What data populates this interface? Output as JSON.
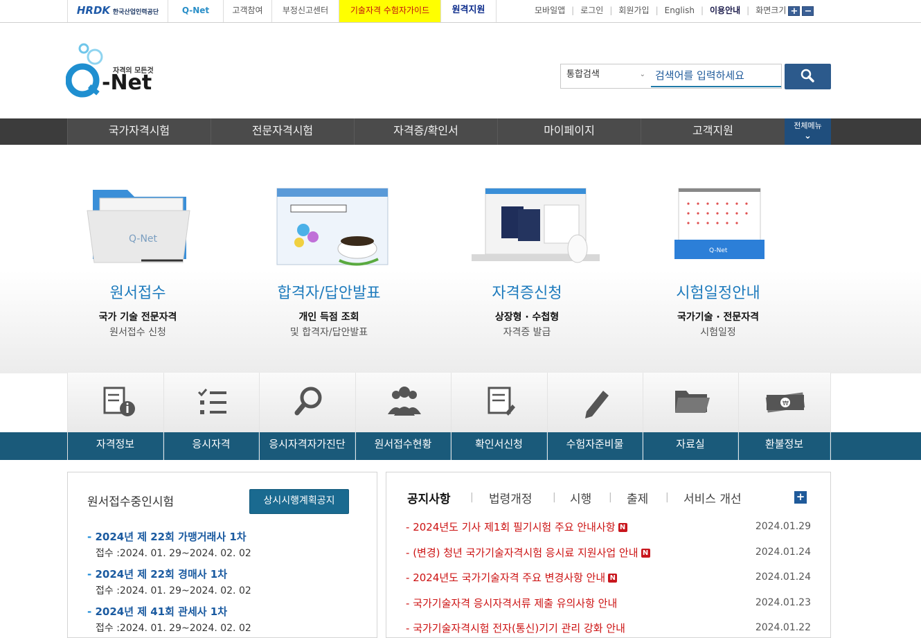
{
  "topbar": {
    "hrdk_label": "HRDK",
    "hrdk_sub": "한국산업인력공단",
    "qnet_label": "Q-Net",
    "links": [
      "고객참여",
      "부정신고센터",
      "기술자격 수험자가이드",
      "원격지원"
    ],
    "util_links": [
      "모바일앱",
      "로그인",
      "회원가입",
      "English",
      "이용안내",
      "화면크기"
    ],
    "zoom_in": "+",
    "zoom_out": "−"
  },
  "logo": {
    "tagline": "자격의 모든것",
    "name": "-Net"
  },
  "search": {
    "category": "통합검색",
    "placeholder": "검색어를 입력하세요"
  },
  "nav": {
    "items": [
      "국가자격시험",
      "전문자격시험",
      "자격증/확인서",
      "마이페이지",
      "고객지원"
    ],
    "all_menu": "전체메뉴"
  },
  "hero": [
    {
      "title": "원서접수",
      "sub1": "국가 기술 전문자격",
      "sub2": "원서접수 신청",
      "icon": "folder-icon"
    },
    {
      "title": "합격자/답안발표",
      "sub1": "개인 득점 조회",
      "sub2": "및 합격자/답안발표",
      "icon": "browser-icon"
    },
    {
      "title": "자격증신청",
      "sub1": "상장형 · 수첩형",
      "sub2": "자격증 발급",
      "icon": "certificate-icon"
    },
    {
      "title": "시험일정안내",
      "sub1": "국가기술 · 전문자격",
      "sub2": "시험일정",
      "icon": "calendar-icon"
    }
  ],
  "quick": [
    {
      "label": "자격정보",
      "icon": "info-document-icon"
    },
    {
      "label": "응시자격",
      "icon": "checklist-icon"
    },
    {
      "label": "응시자격자가진단",
      "icon": "search-icon"
    },
    {
      "label": "원서접수현황",
      "icon": "people-icon"
    },
    {
      "label": "확인서신청",
      "icon": "edit-document-icon"
    },
    {
      "label": "수험자준비물",
      "icon": "pencil-icon"
    },
    {
      "label": "자료실",
      "icon": "folder-icon"
    },
    {
      "label": "환불정보",
      "icon": "money-icon"
    }
  ],
  "exams": {
    "title": "원서접수중인시험",
    "plan_button": "상시시행계획공지",
    "items": [
      {
        "name": "2024년 제 22회 가맹거래사 1차",
        "date": "접수 :2024. 01. 29~2024. 02. 02"
      },
      {
        "name": "2024년 제 22회 경매사 1차",
        "date": "접수 :2024. 01. 29~2024. 02. 02"
      },
      {
        "name": "2024년 제 41회 관세사 1차",
        "date": "접수 :2024. 01. 29~2024. 02. 02"
      }
    ]
  },
  "notices": {
    "tabs": [
      "공지사항",
      "법령개정",
      "시행",
      "출제",
      "서비스 개선"
    ],
    "more": "+",
    "new_badge": "N",
    "items": [
      {
        "text": "2024년도 기사 제1회 필기시험 주요 안내사항",
        "date": "2024.01.29",
        "new": true
      },
      {
        "text": "(변경) 청년 국가기술자격시험 응시료 지원사업 안내",
        "date": "2024.01.24",
        "new": true
      },
      {
        "text": "2024년도 국가기술자격 주요 변경사항 안내",
        "date": "2024.01.24",
        "new": true
      },
      {
        "text": "국가기술자격 응시자격서류 제출 유의사항 안내",
        "date": "2024.01.23",
        "new": false
      },
      {
        "text": "국가기술자격시험 전자(통신)기기 관리 강화 안내",
        "date": "2024.01.22",
        "new": false
      }
    ]
  },
  "colors": {
    "accent": "#1a5a7a",
    "nav": "#4b4b4b",
    "highlight": "#ffff00",
    "notice_red": "#cc1111"
  }
}
